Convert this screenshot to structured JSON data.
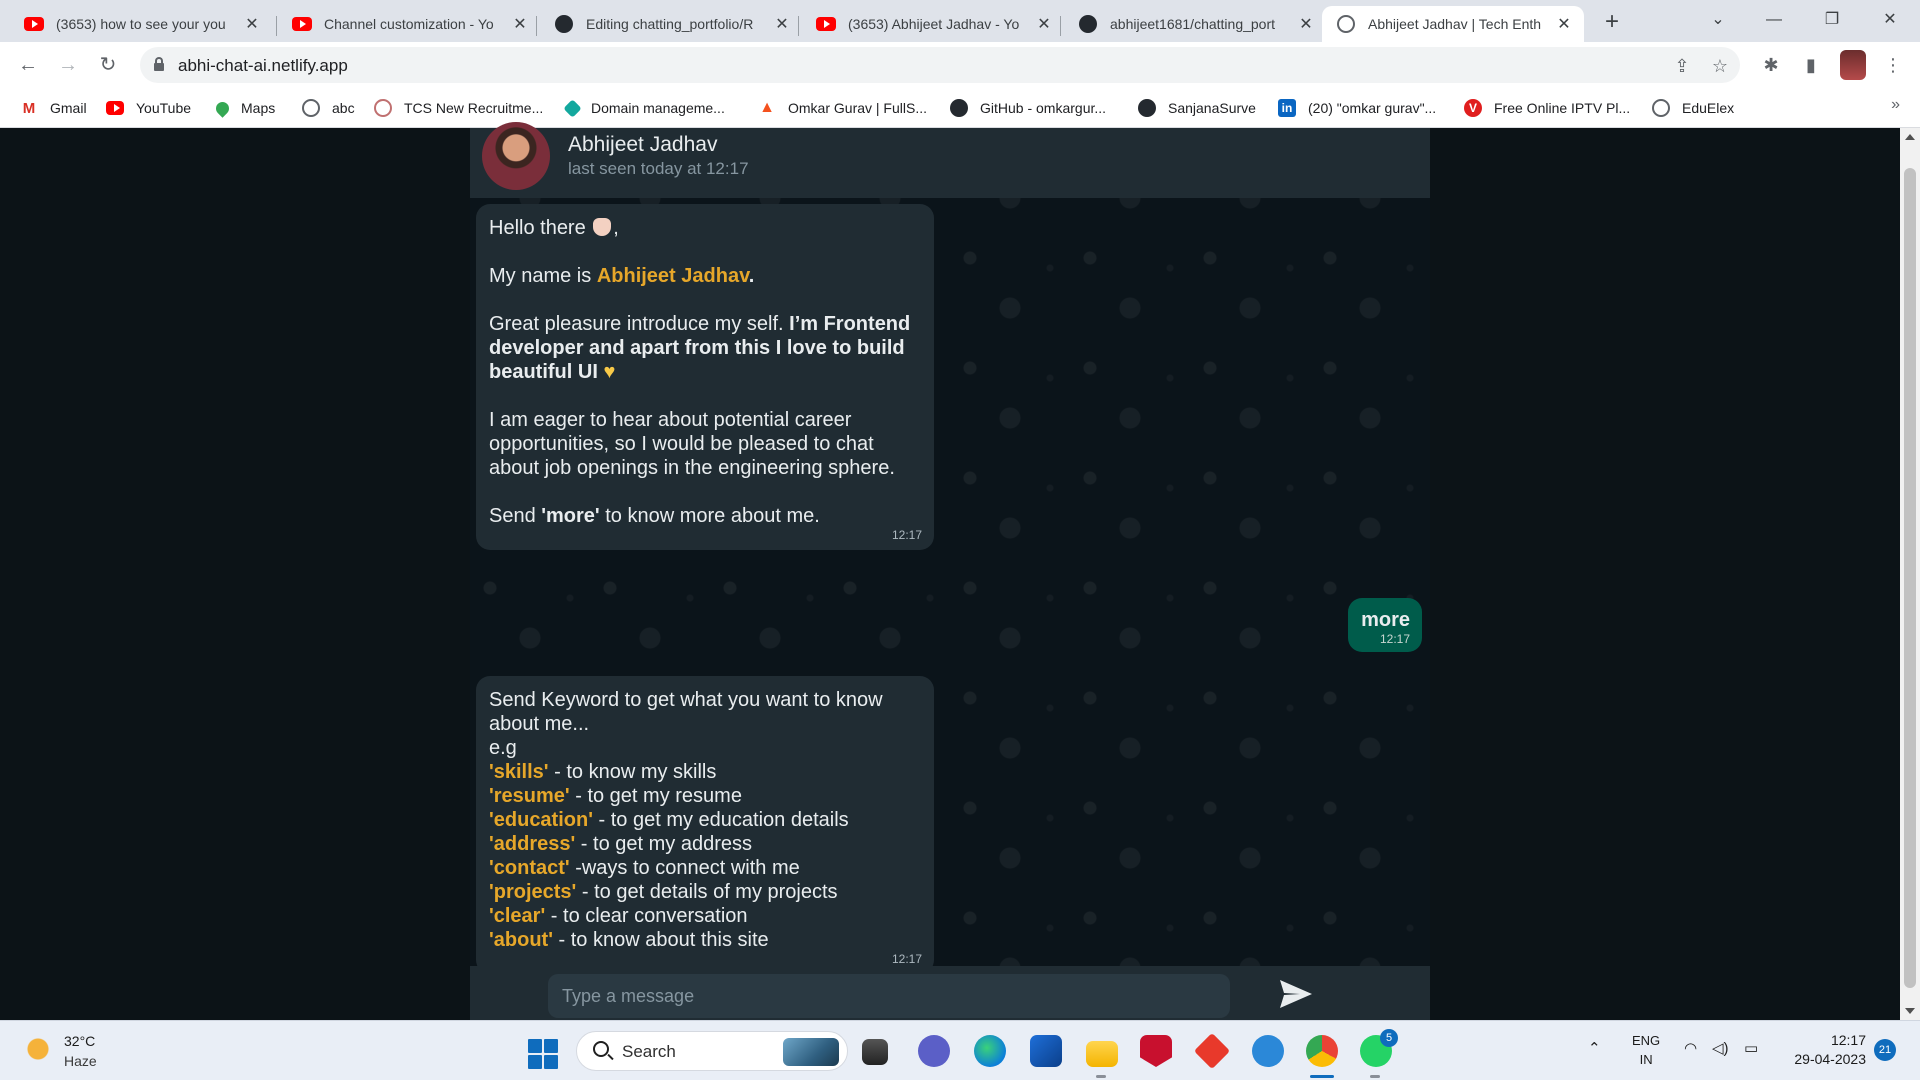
{
  "browser": {
    "tabs": [
      {
        "title": "(3653) how to see your you",
        "icon": "youtube-icon"
      },
      {
        "title": "Channel customization - Yo",
        "icon": "youtube-icon"
      },
      {
        "title": "Editing chatting_portfolio/R",
        "icon": "github-icon"
      },
      {
        "title": "(3653) Abhijeet Jadhav - Yo",
        "icon": "youtube-icon"
      },
      {
        "title": "abhijeet1681/chatting_port",
        "icon": "github-icon"
      },
      {
        "title": "Abhijeet Jadhav | Tech Enth",
        "icon": "globe-icon",
        "active": true
      }
    ],
    "url": "abhi-chat-ai.netlify.app",
    "bookmarks": [
      {
        "label": "Gmail",
        "icon": "gmail-icon"
      },
      {
        "label": "YouTube",
        "icon": "youtube-icon"
      },
      {
        "label": "Maps",
        "icon": "maps-icon"
      },
      {
        "label": "abc",
        "icon": "globe-icon"
      },
      {
        "label": "TCS New Recruitme...",
        "icon": "tcs-icon"
      },
      {
        "label": "Domain manageme...",
        "icon": "domain-icon"
      },
      {
        "label": "Omkar Gurav | FullS...",
        "icon": "flame-icon"
      },
      {
        "label": "GitHub - omkargur...",
        "icon": "github-icon"
      },
      {
        "label": "SanjanaSurve",
        "icon": "github-icon"
      },
      {
        "label": "(20) \"omkar gurav\"...",
        "icon": "linkedin-icon"
      },
      {
        "label": "Free Online IPTV Pl...",
        "icon": "v-icon"
      },
      {
        "label": "EduElex",
        "icon": "globe-icon"
      }
    ]
  },
  "chat": {
    "contact": {
      "name": "Abhijeet Jadhav",
      "status": "last seen today at 12:17"
    },
    "messages": [
      {
        "direction": "incoming",
        "greeting": "Hello there",
        "greeting_suffix": ",",
        "name_prefix": "My name is ",
        "name": "Abhijeet Jadhav",
        "name_suffix": ".",
        "intro_plain": "Great pleasure introduce my self. ",
        "intro_bold": "I’m Frontend developer and apart from this I love to build beautiful UI",
        "career": "I am eager to hear about potential career opportunities, so I would be pleased to chat about job openings in the engineering sphere.",
        "send_prefix": "Send ",
        "send_keyword": "'more'",
        "send_suffix": " to know more about me.",
        "time": "12:17"
      },
      {
        "direction": "outgoing",
        "text": "more",
        "time": "12:17"
      },
      {
        "direction": "incoming",
        "intro": "Send Keyword to get what you want to know about me...",
        "eg": "e.g",
        "keywords": [
          {
            "key": "'skills'",
            "desc": " - to know my skills"
          },
          {
            "key": "'resume'",
            "desc": " - to get my resume"
          },
          {
            "key": "'education'",
            "desc": " - to get my education details"
          },
          {
            "key": "'address'",
            "desc": " - to get my address"
          },
          {
            "key": "'contact'",
            "desc": " -ways to connect with me"
          },
          {
            "key": "'projects'",
            "desc": " - to get details of my projects"
          },
          {
            "key": "'clear'",
            "desc": " - to clear conversation"
          },
          {
            "key": "'about'",
            "desc": " - to know about this site"
          }
        ],
        "time": "12:17"
      }
    ],
    "input_placeholder": "Type a message"
  },
  "taskbar": {
    "weather": {
      "temp": "32°C",
      "condition": "Haze"
    },
    "search_label": "Search",
    "whatsapp_badge": "5",
    "lang_line1": "ENG",
    "lang_line2": "IN",
    "time": "12:17",
    "date": "29-04-2023",
    "notifications": "21"
  },
  "colors": {
    "chat_bg": "#0b141a",
    "incoming_bubble": "#202c33",
    "outgoing_bubble": "#005c4b",
    "highlight": "#e6a72a"
  }
}
